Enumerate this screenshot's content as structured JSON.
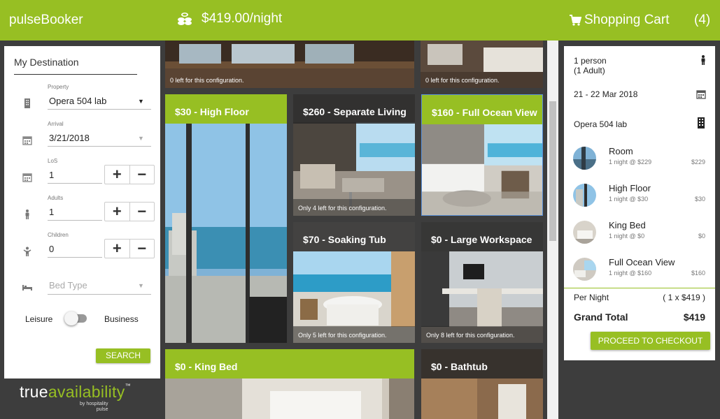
{
  "app": {
    "brand": "pulseBooker"
  },
  "header": {
    "price": "$419.00/night",
    "cart_label": "Shopping Cart",
    "cart_count": "(4)",
    "accent_color": "#97bf23"
  },
  "search_panel": {
    "title": "My Destination",
    "property": {
      "label": "Property",
      "value": "Opera 504 lab"
    },
    "arrival": {
      "label": "Arrival",
      "value": "3/21/2018"
    },
    "los": {
      "label": "LoS",
      "value": "1"
    },
    "adults": {
      "label": "Adults",
      "value": "1"
    },
    "children": {
      "label": "Children",
      "value": "0"
    },
    "bed_type": {
      "placeholder": "Bed Type"
    },
    "toggle": {
      "left_label": "Leisure",
      "right_label": "Business"
    },
    "search_button": "SEARCH",
    "plus": "+",
    "minus": "−"
  },
  "logo": {
    "part1": "true",
    "part2": "availability",
    "tm": "™",
    "sub_line1": "by hospitality",
    "sub_line2": "pulse"
  },
  "rooms": [
    {
      "title": "",
      "availability": "0 left for this configuration."
    },
    {
      "title": "",
      "availability": "0 left for this configuration."
    },
    {
      "title": "$30 - High Floor",
      "availability": ""
    },
    {
      "title": "$260 - Separate Living",
      "availability": "Only 4 left for this configuration."
    },
    {
      "title": "$160 - Full Ocean View",
      "availability": ""
    },
    {
      "title": "$70 - Soaking Tub",
      "availability": "Only 5 left for this configuration."
    },
    {
      "title": "$0 - Large Workspace",
      "availability": "Only 8 left for this configuration."
    },
    {
      "title": "$0 - King Bed",
      "availability": ""
    },
    {
      "title": "$0 - Bathtub",
      "availability": ""
    }
  ],
  "summary": {
    "guests_line1": "1 person",
    "guests_line2": "(1 Adult)",
    "dates": "21 - 22 Mar 2018",
    "property": "Opera 504 lab",
    "items": [
      {
        "name": "Room",
        "detail": "1 night @ $229",
        "price": "$229"
      },
      {
        "name": "High Floor",
        "detail": "1 night @ $30",
        "price": "$30"
      },
      {
        "name": "King Bed",
        "detail": "1 night @ $0",
        "price": "$0"
      },
      {
        "name": "Full Ocean View",
        "detail": "1 night @ $160",
        "price": "$160"
      }
    ],
    "per_night_label": "Per Night",
    "per_night_value": "( 1 x $419 )",
    "grand_total_label": "Grand Total",
    "grand_total_value": "$419",
    "checkout_button": "PROCEED TO CHECKOUT"
  }
}
